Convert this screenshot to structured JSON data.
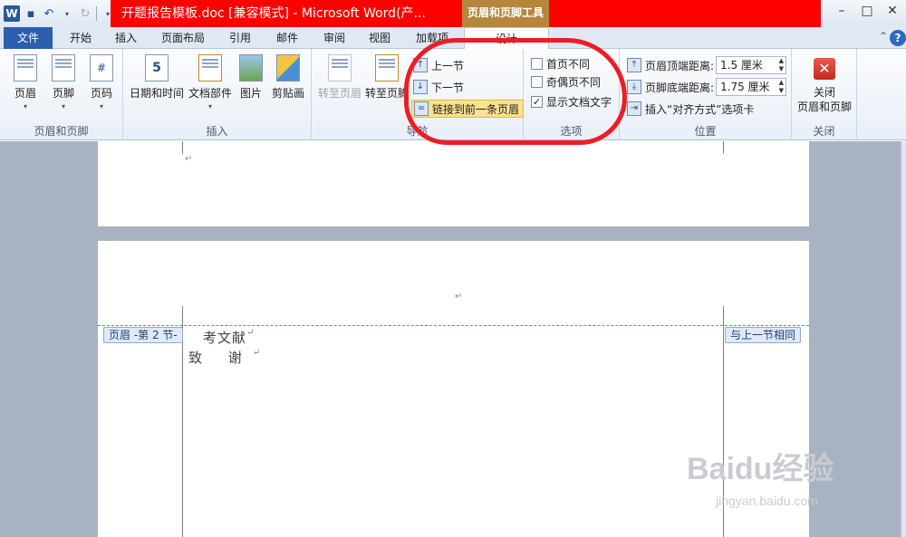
{
  "titlebar": {
    "app_icon": "W",
    "title": "开题报告模板.doc [兼容模式] - Microsoft Word(产...",
    "context_tab": "页眉和页脚工具"
  },
  "tabs": [
    "文件",
    "开始",
    "插入",
    "页面布局",
    "引用",
    "邮件",
    "审阅",
    "视图",
    "加载项",
    "设计"
  ],
  "ribbon": {
    "group_header_footer": {
      "label": "页眉和页脚",
      "buttons": [
        "页眉",
        "页脚",
        "页码"
      ]
    },
    "group_insert": {
      "label": "插入",
      "buttons": [
        "日期和时间",
        "文档部件",
        "图片",
        "剪贴画"
      ]
    },
    "group_nav": {
      "label": "导航",
      "goto_header": "转至页眉",
      "goto_footer": "转至页脚",
      "prev_section": "上一节",
      "next_section": "下一节",
      "link_previous": "链接到前一条页眉"
    },
    "group_options": {
      "label": "选项",
      "first_page": "首页不同",
      "odd_even": "奇偶页不同",
      "show_text": "显示文档文字",
      "first_page_checked": false,
      "odd_even_checked": false,
      "show_text_checked": true
    },
    "group_position": {
      "label": "位置",
      "header_top_label": "页眉顶端距离:",
      "header_top_value": "1.5 厘米",
      "footer_bottom_label": "页脚底端距离:",
      "footer_bottom_value": "1.75 厘米",
      "insert_align": "插入“对齐方式”选项卡"
    },
    "group_close": {
      "label": "关闭",
      "button": "关闭\n页眉和页脚"
    }
  },
  "document": {
    "header_tag": "页眉 -第 2 节-",
    "same_as_previous": "与上一节相同",
    "line1": "考文献",
    "line2": "致 谢",
    "para_mark": "↵"
  },
  "watermark": {
    "text": "Baidu经验",
    "url": "jingyan.baidu.com"
  }
}
